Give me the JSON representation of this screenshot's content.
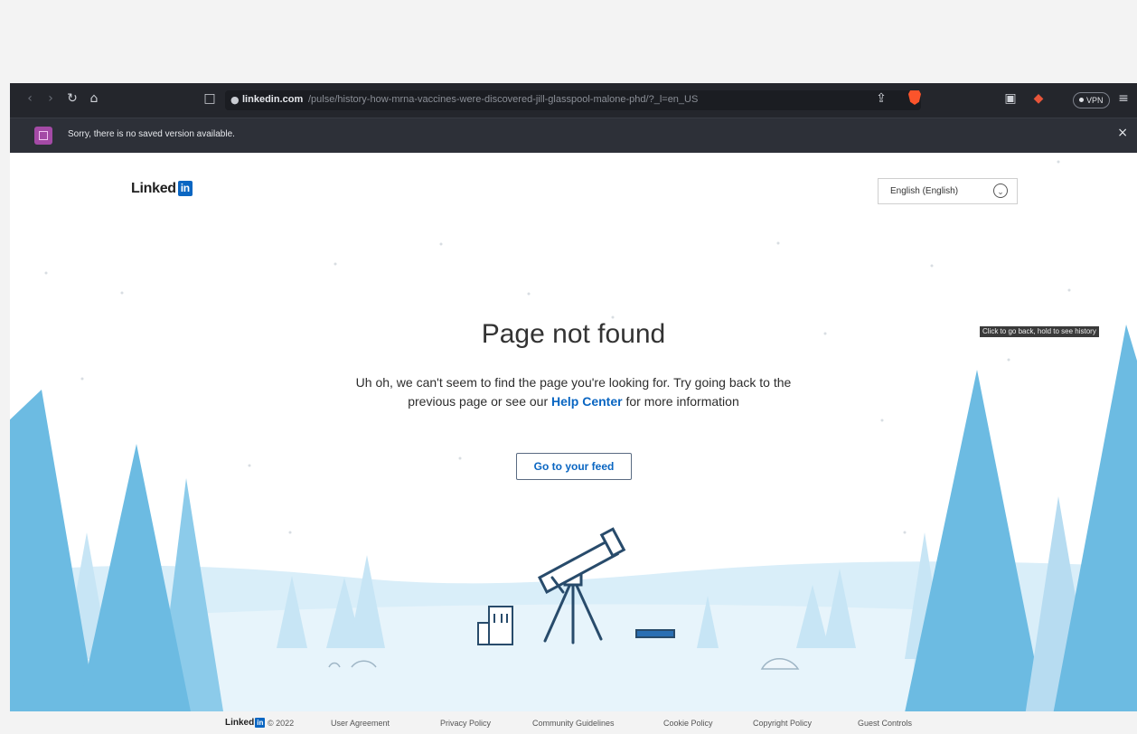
{
  "browser": {
    "url_host": "linkedin.com",
    "url_path": "/pulse/history-how-mrna-vaccines-were-discovered-jill-glasspool-malone-phd/?_l=en_US",
    "vpn_label": "VPN",
    "infobar_text": "Sorry, there is no saved version available.",
    "tooltip": "Click to go back, hold to see history",
    "icons": {
      "back": "back-icon",
      "forward": "forward-icon",
      "reload": "reload-icon",
      "home": "home-icon",
      "bookmark": "bookmark-icon",
      "lock": "lock-icon",
      "share": "share-icon",
      "brave": "brave-shield-icon",
      "sidebar": "sidebar-icon",
      "rewards": "rewards-icon",
      "menu": "menu-icon",
      "close": "close-icon"
    }
  },
  "header": {
    "logo_text": "Linked",
    "logo_badge": "in",
    "language": "English (English)"
  },
  "main": {
    "title": "Page not found",
    "desc_before": "Uh oh, we can't seem to find the page you're looking for. Try going back to the previous page or see our ",
    "help_link": "Help Center",
    "desc_after": " for more information",
    "feed_button": "Go to your feed"
  },
  "footer": {
    "logo_text": "Linked",
    "logo_badge": "in",
    "copyright": "© 2022",
    "links": [
      "User Agreement",
      "Privacy Policy",
      "Community Guidelines",
      "Cookie Policy",
      "Copyright Policy",
      "Guest Controls"
    ]
  },
  "colors": {
    "brand_blue": "#0a66c2",
    "tree_blue": "#6cbbe2",
    "tree_light": "#b7dcf1",
    "snow": "#d9eef9",
    "toolbar_bg": "#24262c"
  }
}
